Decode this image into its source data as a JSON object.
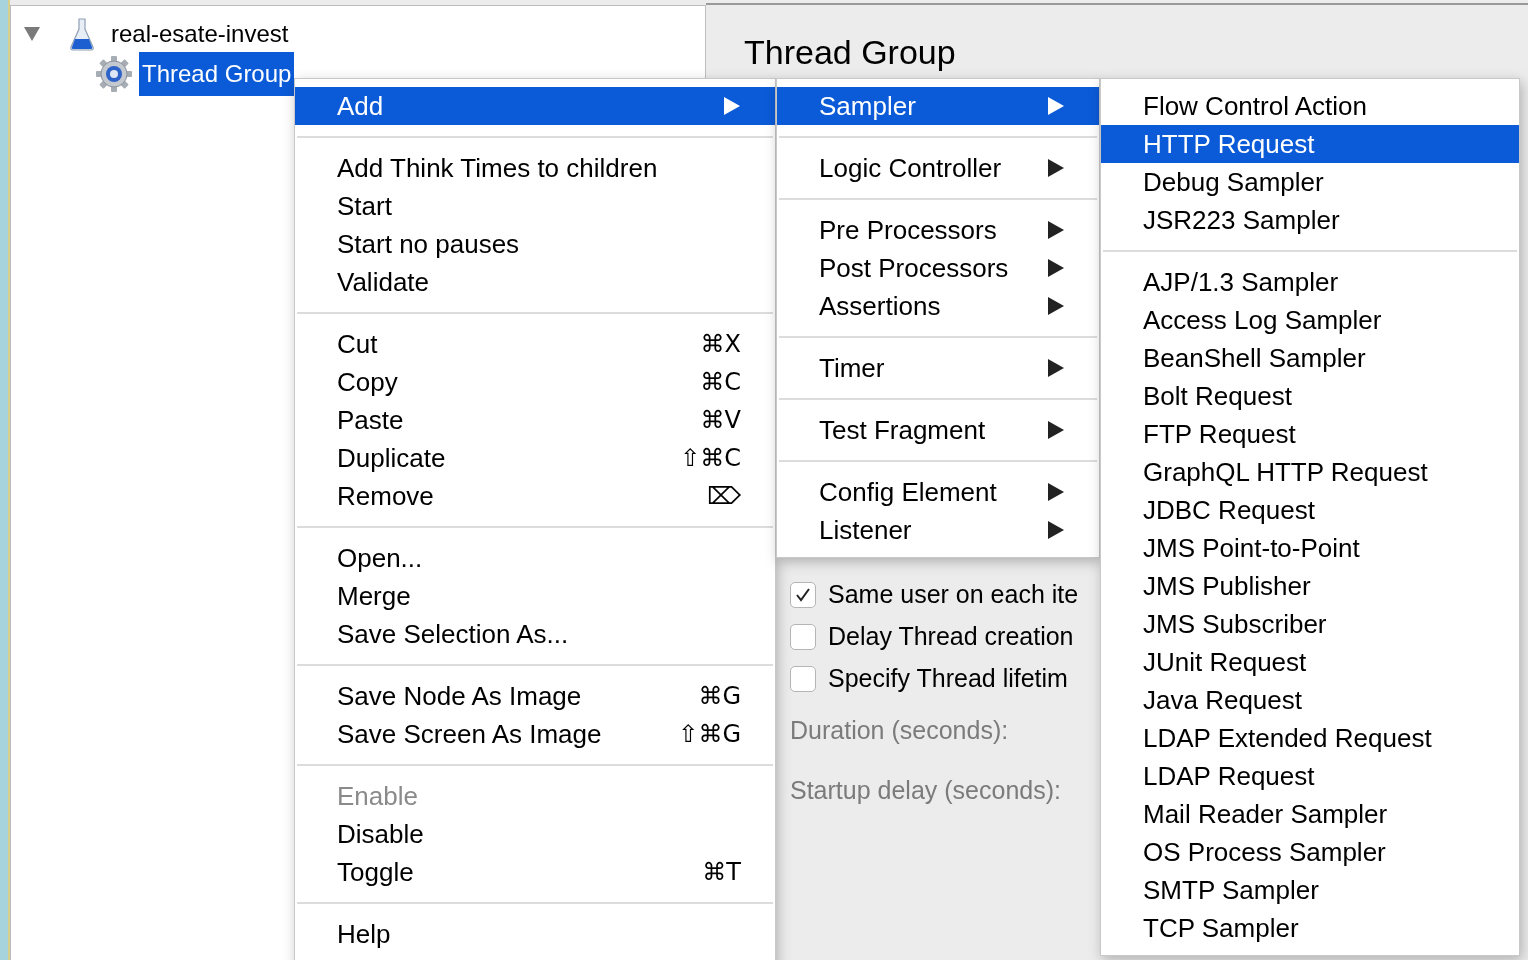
{
  "tree": {
    "items": [
      {
        "label": "real-esate-invest",
        "expanded": true,
        "selected": false,
        "children": [
          {
            "label": "Thread Group",
            "selected": true
          }
        ]
      }
    ]
  },
  "panel": {
    "title": "Thread Group",
    "checkboxes": [
      {
        "label": "Same user on each ite",
        "checked": true
      },
      {
        "label": "Delay Thread creation",
        "checked": false
      },
      {
        "label": "Specify Thread lifetim",
        "checked": false
      }
    ],
    "fields": [
      "Duration (seconds):",
      "Startup delay (seconds):"
    ]
  },
  "context_menu": {
    "groups": [
      [
        {
          "label": "Add",
          "submenu": true,
          "selected": true,
          "disabled": false
        }
      ],
      [
        {
          "label": "Add Think Times to children",
          "selected": false,
          "disabled": false
        },
        {
          "label": "Start",
          "selected": false,
          "disabled": false
        },
        {
          "label": "Start no pauses",
          "selected": false,
          "disabled": false
        },
        {
          "label": "Validate",
          "selected": false,
          "disabled": false
        }
      ],
      [
        {
          "label": "Cut",
          "shortcut": "⌘X",
          "selected": false,
          "disabled": false
        },
        {
          "label": "Copy",
          "shortcut": "⌘C",
          "selected": false,
          "disabled": false
        },
        {
          "label": "Paste",
          "shortcut": "⌘V",
          "selected": false,
          "disabled": false
        },
        {
          "label": "Duplicate",
          "shortcut": "⇧⌘C",
          "selected": false,
          "disabled": false
        },
        {
          "label": "Remove",
          "shortcut": "⌦",
          "selected": false,
          "disabled": false
        }
      ],
      [
        {
          "label": "Open...",
          "selected": false,
          "disabled": false
        },
        {
          "label": "Merge",
          "selected": false,
          "disabled": false
        },
        {
          "label": "Save Selection As...",
          "selected": false,
          "disabled": false
        }
      ],
      [
        {
          "label": "Save Node As Image",
          "shortcut": "⌘G",
          "selected": false,
          "disabled": false
        },
        {
          "label": "Save Screen As Image",
          "shortcut": "⇧⌘G",
          "selected": false,
          "disabled": false
        }
      ],
      [
        {
          "label": "Enable",
          "selected": false,
          "disabled": true
        },
        {
          "label": "Disable",
          "selected": false,
          "disabled": false
        },
        {
          "label": "Toggle",
          "shortcut": "⌘T",
          "selected": false,
          "disabled": false
        }
      ],
      [
        {
          "label": "Help",
          "selected": false,
          "disabled": false
        }
      ]
    ]
  },
  "add_submenu": {
    "groups": [
      [
        {
          "label": "Sampler",
          "submenu": true,
          "selected": true
        }
      ],
      [
        {
          "label": "Logic Controller",
          "submenu": true,
          "selected": false
        }
      ],
      [
        {
          "label": "Pre Processors",
          "submenu": true,
          "selected": false
        },
        {
          "label": "Post Processors",
          "submenu": true,
          "selected": false
        },
        {
          "label": "Assertions",
          "submenu": true,
          "selected": false
        }
      ],
      [
        {
          "label": "Timer",
          "submenu": true,
          "selected": false
        }
      ],
      [
        {
          "label": "Test Fragment",
          "submenu": true,
          "selected": false
        }
      ],
      [
        {
          "label": "Config Element",
          "submenu": true,
          "selected": false
        },
        {
          "label": "Listener",
          "submenu": true,
          "selected": false
        }
      ]
    ]
  },
  "sampler_submenu": {
    "groups": [
      [
        {
          "label": "Flow Control Action",
          "selected": false
        },
        {
          "label": "HTTP Request",
          "selected": true
        },
        {
          "label": "Debug Sampler",
          "selected": false
        },
        {
          "label": "JSR223 Sampler",
          "selected": false
        }
      ],
      [
        {
          "label": "AJP/1.3 Sampler",
          "selected": false
        },
        {
          "label": "Access Log Sampler",
          "selected": false
        },
        {
          "label": "BeanShell Sampler",
          "selected": false
        },
        {
          "label": "Bolt Request",
          "selected": false
        },
        {
          "label": "FTP Request",
          "selected": false
        },
        {
          "label": "GraphQL HTTP Request",
          "selected": false
        },
        {
          "label": "JDBC Request",
          "selected": false
        },
        {
          "label": "JMS Point-to-Point",
          "selected": false
        },
        {
          "label": "JMS Publisher",
          "selected": false
        },
        {
          "label": "JMS Subscriber",
          "selected": false
        },
        {
          "label": "JUnit Request",
          "selected": false
        },
        {
          "label": "Java Request",
          "selected": false
        },
        {
          "label": "LDAP Extended Request",
          "selected": false
        },
        {
          "label": "LDAP Request",
          "selected": false
        },
        {
          "label": "Mail Reader Sampler",
          "selected": false
        },
        {
          "label": "OS Process Sampler",
          "selected": false
        },
        {
          "label": "SMTP Sampler",
          "selected": false
        },
        {
          "label": "TCP Sampler",
          "selected": false
        }
      ]
    ]
  }
}
